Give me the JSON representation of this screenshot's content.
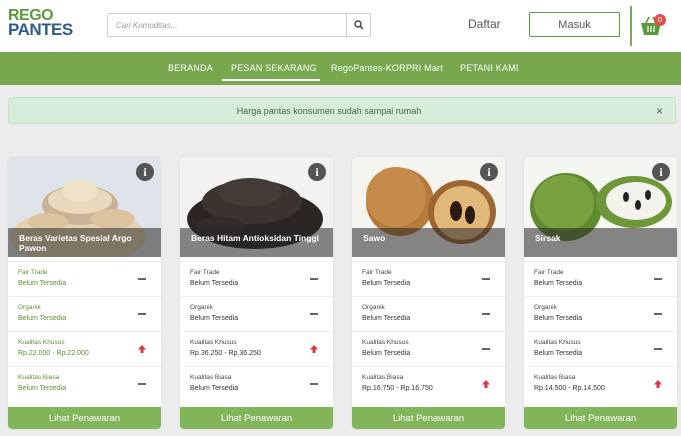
{
  "header": {
    "logo_line1": "REGO",
    "logo_line2": "PANTES",
    "search_placeholder": "Cari Komoditas...",
    "daftar_label": "Daftar",
    "masuk_label": "Masuk",
    "cart_count": "0"
  },
  "nav": {
    "items": [
      "BERANDA",
      "PESAN SEKARANG",
      "RegoPantes-KORPRI Mart",
      "PETANI KAMI"
    ],
    "active_index": 1
  },
  "alert": {
    "text": "Harga pantas konsumen sudah sampai rumah",
    "close": "×"
  },
  "colors": {
    "brand_green": "#77a84d",
    "button_green": "#82b45a",
    "up_arrow": "#d9363e"
  },
  "cards": [
    {
      "name": "Beras Varietas Spesial Argo Pawon",
      "info_icon": "i",
      "rows": [
        {
          "label": "Fair Trade",
          "value": "Belum Tersedia",
          "indicator": "dash-icon"
        },
        {
          "label": "Organik",
          "value": "Belum Tersedia",
          "indicator": "dash-icon"
        },
        {
          "label": "Kualitas Khusus",
          "value": "Rp.22.000 - Rp.22.000",
          "indicator": "arrow-up-icon"
        },
        {
          "label": "Kualitas Biasa",
          "value": "Belum Tersedia",
          "indicator": "dash-icon"
        }
      ],
      "button_label": "Lihat Penawaran"
    },
    {
      "name": "Beras Hitam Antioksidan Tinggi",
      "info_icon": "i",
      "rows": [
        {
          "label": "Fair Trade",
          "value": "Belum Tersedia",
          "indicator": "dash-icon"
        },
        {
          "label": "Organik",
          "value": "Belum Tersedia",
          "indicator": "dash-icon"
        },
        {
          "label": "Kualitas Khusus",
          "value": "Rp.36.250 - Rp.36.250",
          "indicator": "arrow-up-icon"
        },
        {
          "label": "Kualitas Biasa",
          "value": "Belum Tersedia",
          "indicator": "dash-icon"
        }
      ],
      "button_label": "Lihat Penawaran"
    },
    {
      "name": "Sawo",
      "info_icon": "i",
      "rows": [
        {
          "label": "Fair Trade",
          "value": "Belum Tersedia",
          "indicator": "dash-icon"
        },
        {
          "label": "Organik",
          "value": "Belum Tersedia",
          "indicator": "dash-icon"
        },
        {
          "label": "Kualitas Khusus",
          "value": "Belum Tersedia",
          "indicator": "dash-icon"
        },
        {
          "label": "Kualitas Biasa",
          "value": "Rp.16.750 - Rp.16.750",
          "indicator": "arrow-up-icon"
        }
      ],
      "button_label": "Lihat Penawaran"
    },
    {
      "name": "Sirsak",
      "info_icon": "i",
      "rows": [
        {
          "label": "Fair Trade",
          "value": "Belum Tersedia",
          "indicator": "dash-icon"
        },
        {
          "label": "Organik",
          "value": "Belum Tersedia",
          "indicator": "dash-icon"
        },
        {
          "label": "Kualitas Khusus",
          "value": "Belum Tersedia",
          "indicator": "dash-icon"
        },
        {
          "label": "Kualitas Biasa",
          "value": "Rp.14.500 - Rp.14.500",
          "indicator": "arrow-up-icon"
        }
      ],
      "button_label": "Lihat Penawaran"
    }
  ]
}
